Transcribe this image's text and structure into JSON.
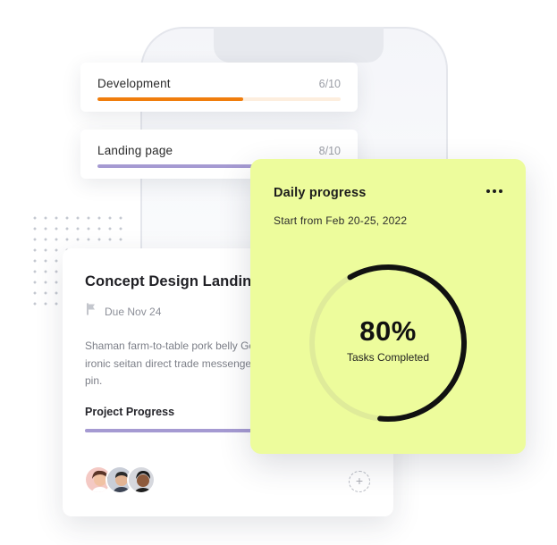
{
  "tasks": [
    {
      "title": "Development",
      "count": "6/10",
      "progress": 0.6
    },
    {
      "title": "Landing page",
      "count": "8/10",
      "progress": 0.8
    }
  ],
  "concept": {
    "title": "Concept Design Landing",
    "due": "Due Nov 24",
    "description": "Shaman farm-to-table pork belly Gentrify dreamcatcher post-ironic seitan direct trade messenger bag flexitarian enamel pin.",
    "progress_label": "Project Progress",
    "progress": 0.8,
    "add_symbol": "+",
    "avatars": [
      "avatar-woman",
      "avatar-man",
      "avatar-man-2"
    ]
  },
  "daily": {
    "title": "Daily progress",
    "subtitle": "Start from Feb 20-25, 2022",
    "percent_text": "80%",
    "percent": 0.8,
    "caption": "Tasks Completed",
    "more_icon": "more-horizontal-icon"
  },
  "colors": {
    "accent_orange": "#f07d0c",
    "accent_purple": "#a59ad2",
    "daily_card_bg": "#edfc9c",
    "ring": "#111111"
  }
}
